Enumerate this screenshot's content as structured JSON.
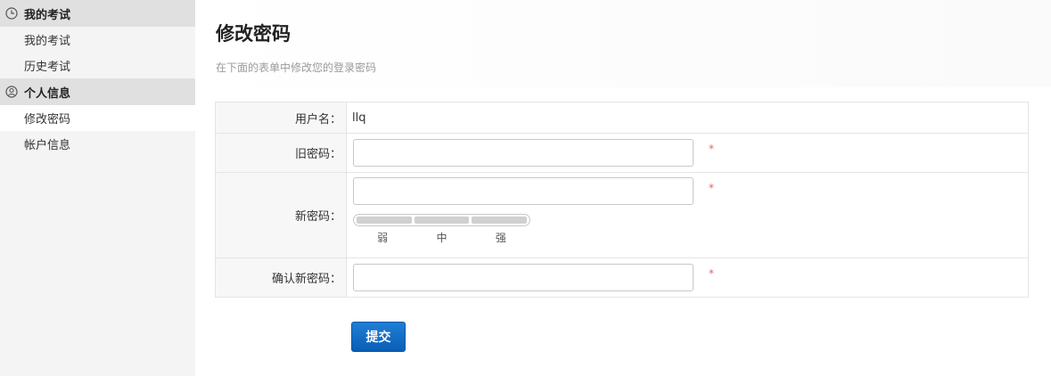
{
  "sidebar": {
    "sections": [
      {
        "title": "我的考试",
        "icon": "clock-icon",
        "items": [
          {
            "label": "我的考试"
          },
          {
            "label": "历史考试"
          }
        ]
      },
      {
        "title": "个人信息",
        "icon": "user-circle-icon",
        "items": [
          {
            "label": "修改密码",
            "active": true
          },
          {
            "label": "帐户信息"
          }
        ]
      }
    ]
  },
  "main": {
    "title": "修改密码",
    "subtitle": "在下面的表单中修改您的登录密码",
    "form": {
      "username_label": "用户名：",
      "username_value": "llq",
      "old_password_label": "旧密码：",
      "new_password_label": "新密码：",
      "confirm_password_label": "确认新密码：",
      "required_mark": "*",
      "strength_labels": [
        "弱",
        "中",
        "强"
      ],
      "submit_label": "提交"
    }
  },
  "colors": {
    "accent": "#0a5db4",
    "required": "#e06666",
    "sidebar_header_bg": "#e0e0e0"
  }
}
